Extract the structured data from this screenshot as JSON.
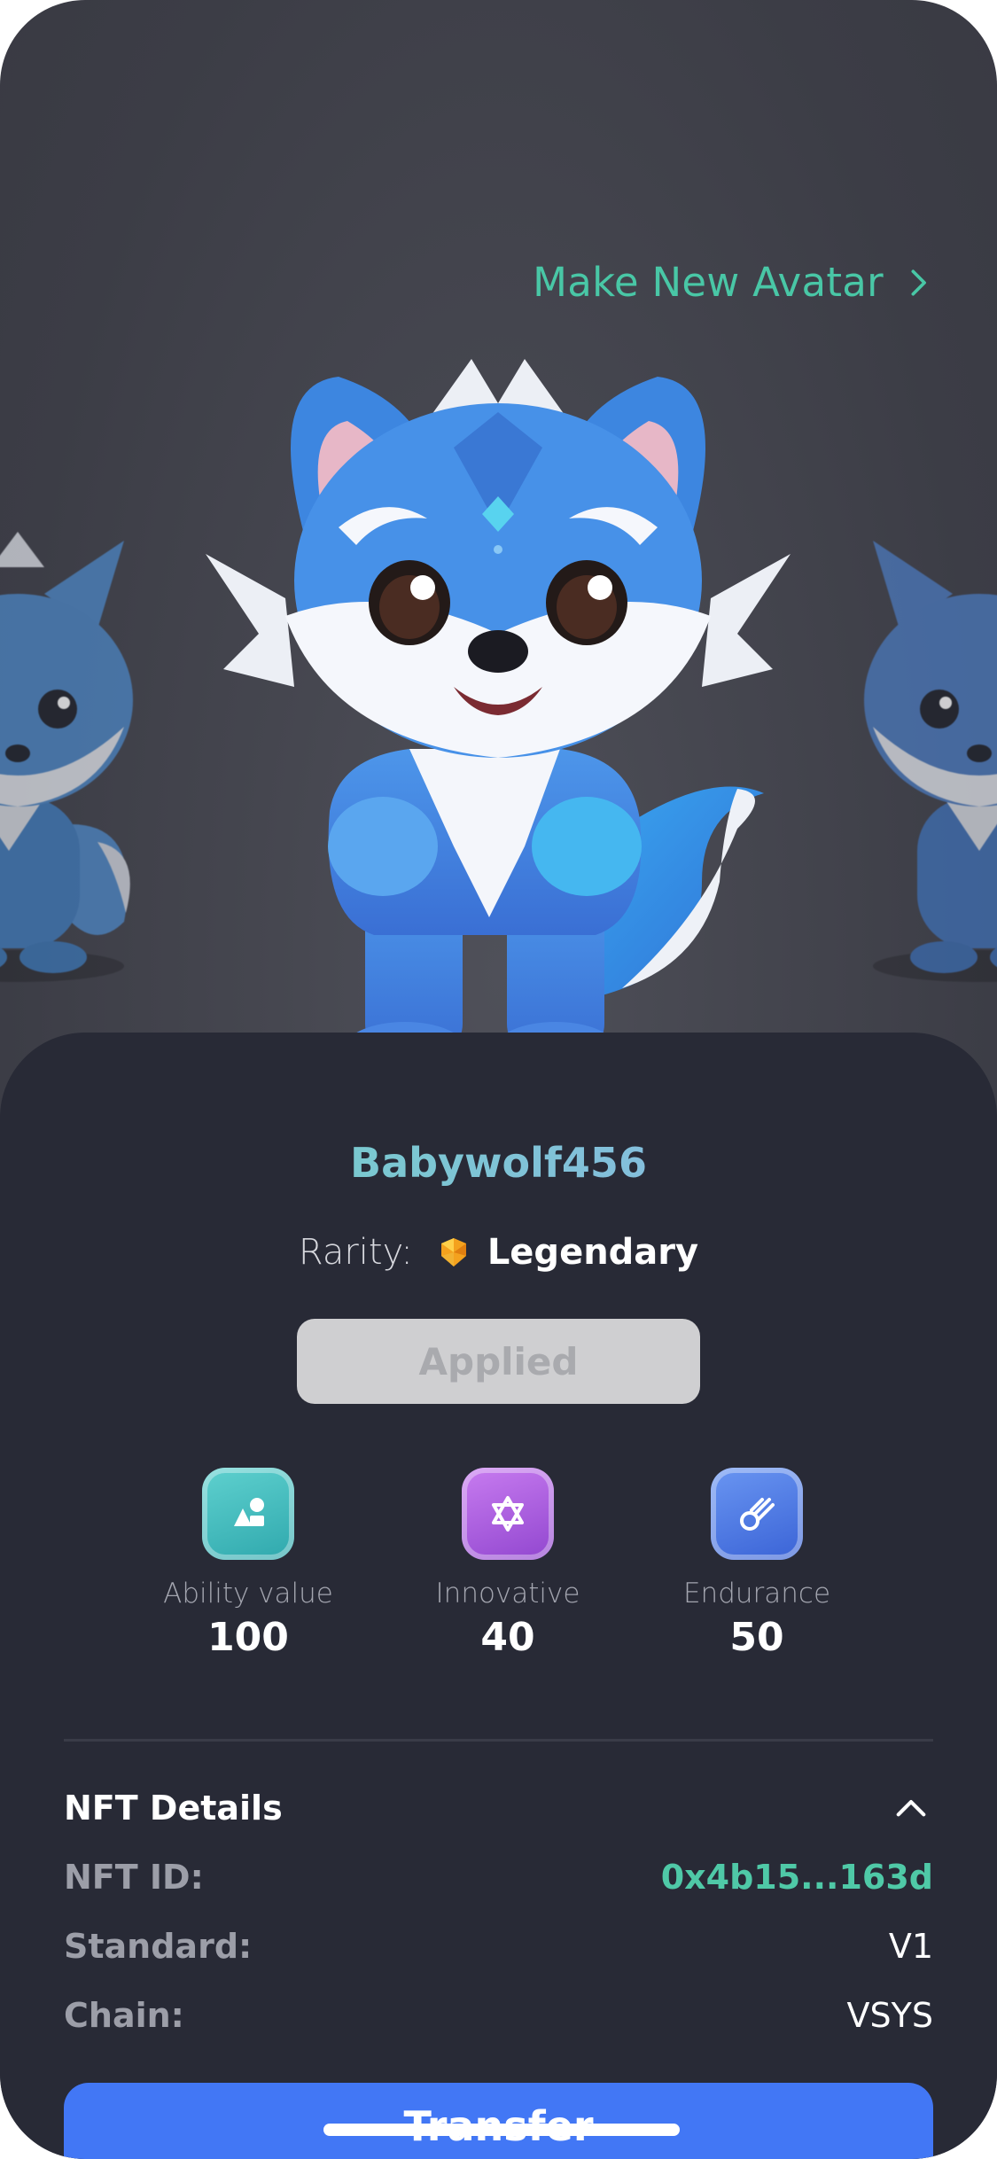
{
  "header": {
    "make_new_label": "Make New Avatar"
  },
  "avatar": {
    "name": "Babywolf456",
    "rarity_label": "Rarity:",
    "rarity_value": "Legendary",
    "status_button": "Applied"
  },
  "stats": [
    {
      "label": "Ability value",
      "value": "100",
      "icon": "shapes-icon",
      "color": "#3bb9b9"
    },
    {
      "label": "Innovative",
      "value": "40",
      "icon": "star-of-david-icon",
      "color": "#a35ad8"
    },
    {
      "label": "Endurance",
      "value": "50",
      "icon": "comet-icon",
      "color": "#4a78e6"
    }
  ],
  "details": {
    "title": "NFT Details",
    "rows": [
      {
        "key": "NFT ID:",
        "value": "0x4b15...163d"
      },
      {
        "key": "Standard:",
        "value": "V1"
      },
      {
        "key": "Chain:",
        "value": "VSYS"
      }
    ]
  },
  "actions": {
    "transfer_label": "Transfer"
  },
  "colors": {
    "accent": "#49c7a6",
    "primary": "#4277f5",
    "panel": "#282a36"
  }
}
